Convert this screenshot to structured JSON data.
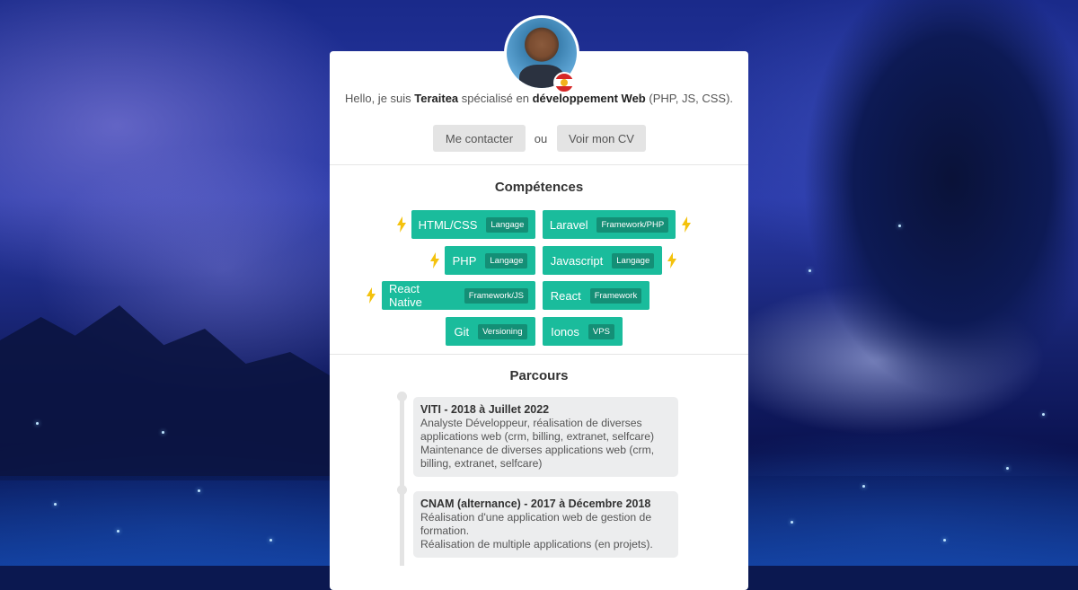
{
  "background": {
    "accent": "#1abc9c"
  },
  "profile": {
    "hello_prefix": "Hello, je suis ",
    "name": "Teraitea",
    "middle": " spécialisé en ",
    "specialty": "développement Web",
    "suffix": " (PHP, JS, CSS)."
  },
  "actions": {
    "contact_label": "Me contacter",
    "or_label": "ou",
    "cv_label": "Voir mon CV"
  },
  "skills_section": {
    "title": "Compétences",
    "items": [
      {
        "name": "HTML/CSS",
        "tag": "Langage",
        "highlight": true
      },
      {
        "name": "Laravel",
        "tag": "Framework/PHP",
        "highlight": true
      },
      {
        "name": "PHP",
        "tag": "Langage",
        "highlight": true
      },
      {
        "name": "Javascript",
        "tag": "Langage",
        "highlight": true
      },
      {
        "name": "React Native",
        "tag": "Framework/JS",
        "highlight": true
      },
      {
        "name": "React",
        "tag": "Framework",
        "highlight": false
      },
      {
        "name": "Git",
        "tag": "Versioning",
        "highlight": false
      },
      {
        "name": "Ionos",
        "tag": "VPS",
        "highlight": false
      }
    ]
  },
  "career_section": {
    "title": "Parcours",
    "entries": [
      {
        "title": "VITI - 2018 à Juillet 2022",
        "lines": [
          "Analyste Développeur, réalisation de diverses applications web (crm, billing, extranet, selfcare)",
          "Maintenance de diverses applications web (crm, billing, extranet, selfcare)"
        ]
      },
      {
        "title": "CNAM (alternance) - 2017 à Décembre 2018",
        "lines": [
          "Réalisation d'une application web de gestion de formation.",
          "Réalisation de multiple applications (en projets)."
        ]
      }
    ]
  }
}
